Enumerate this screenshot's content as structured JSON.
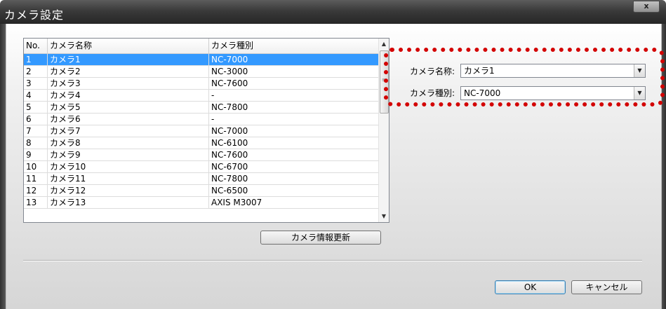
{
  "window": {
    "title": "カメラ設定",
    "close_label": "x"
  },
  "list": {
    "columns": [
      "No.",
      "カメラ名称",
      "カメラ種別"
    ],
    "rows": [
      {
        "no": "1",
        "name": "カメラ1",
        "type": "NC-7000"
      },
      {
        "no": "2",
        "name": "カメラ2",
        "type": "NC-3000"
      },
      {
        "no": "3",
        "name": "カメラ3",
        "type": "NC-7600"
      },
      {
        "no": "4",
        "name": "カメラ4",
        "type": "-"
      },
      {
        "no": "5",
        "name": "カメラ5",
        "type": "NC-7800"
      },
      {
        "no": "6",
        "name": "カメラ6",
        "type": "-"
      },
      {
        "no": "7",
        "name": "カメラ7",
        "type": "NC-7000"
      },
      {
        "no": "8",
        "name": "カメラ8",
        "type": "NC-6100"
      },
      {
        "no": "9",
        "name": "カメラ9",
        "type": "NC-7600"
      },
      {
        "no": "10",
        "name": "カメラ10",
        "type": "NC-6700"
      },
      {
        "no": "11",
        "name": "カメラ11",
        "type": "NC-7800"
      },
      {
        "no": "12",
        "name": "カメラ12",
        "type": "NC-6500"
      },
      {
        "no": "13",
        "name": "カメラ13",
        "type": "AXIS M3007"
      }
    ],
    "selected_index": 0
  },
  "form": {
    "name_label": "カメラ名称:",
    "name_value": "カメラ1",
    "type_label": "カメラ種別:",
    "type_value": "NC-7000"
  },
  "buttons": {
    "refresh": "カメラ情報更新",
    "ok": "OK",
    "cancel": "キャンセル"
  },
  "colors": {
    "selection": "#3399ff",
    "highlight_border": "#d30000"
  },
  "icons": {
    "scroll_up": "▲",
    "scroll_down": "▼",
    "dropdown": "▼",
    "grip": "≡"
  }
}
